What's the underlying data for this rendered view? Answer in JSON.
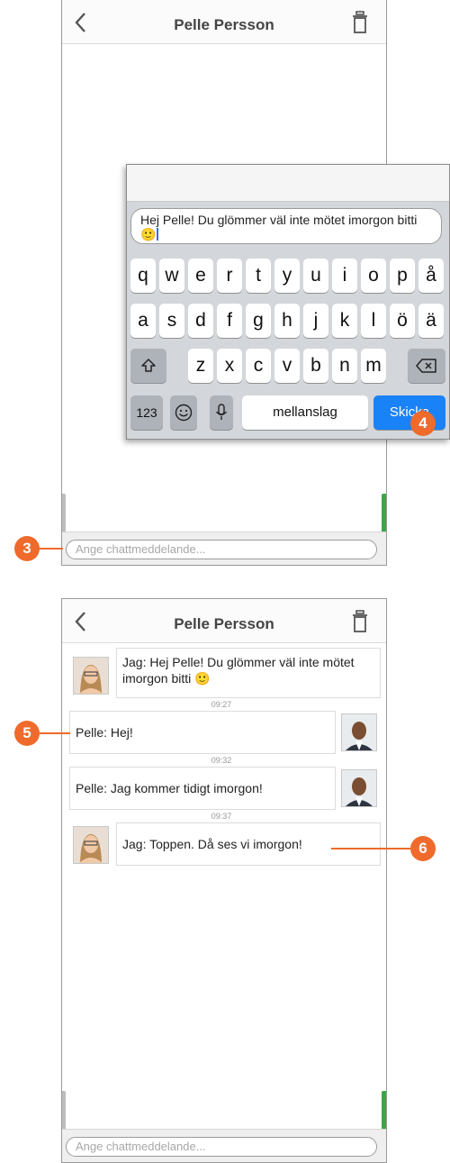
{
  "screen1": {
    "title": "Pelle Persson",
    "input_placeholder": "Ange chattmeddelande...",
    "compose_text": "Hej Pelle! Du glömmer väl inte mötet imorgon bitti 🙂",
    "keyboard": {
      "row1": [
        "q",
        "w",
        "e",
        "r",
        "t",
        "y",
        "u",
        "i",
        "o",
        "p",
        "å"
      ],
      "row2": [
        "a",
        "s",
        "d",
        "f",
        "g",
        "h",
        "j",
        "k",
        "l",
        "ö",
        "ä"
      ],
      "row3": [
        "z",
        "x",
        "c",
        "v",
        "b",
        "n",
        "m"
      ],
      "numbers_label": "123",
      "space_label": "mellanslag",
      "send_label": "Skicka"
    }
  },
  "screen2": {
    "title": "Pelle Persson",
    "input_placeholder": "Ange chattmeddelande...",
    "messages": [
      {
        "text": "Jag: Hej Pelle! Du glömmer väl inte mötet imorgon bitti 🙂",
        "time": "09:27"
      },
      {
        "text": "Pelle: Hej!",
        "time": "09:32"
      },
      {
        "text": "Pelle: Jag kommer tidigt imorgon!",
        "time": "09:37"
      },
      {
        "text": "Jag: Toppen. Då ses vi imorgon!"
      }
    ]
  },
  "callouts": [
    "3",
    "4",
    "5",
    "6"
  ],
  "colors": {
    "accent": "#ef6a2b",
    "send": "#1a82f7",
    "online": "#3aa64a"
  }
}
